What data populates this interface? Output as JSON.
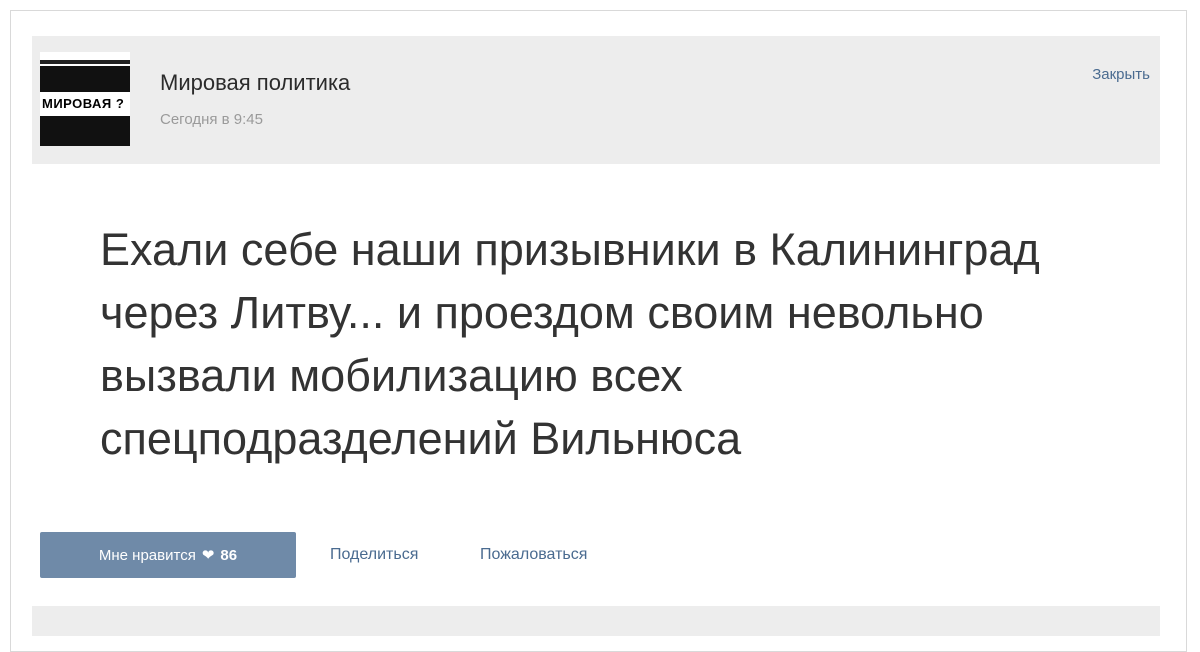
{
  "post": {
    "group_name": "Мировая политика",
    "time": "Сегодня в 9:45",
    "close_label": "Закрыть",
    "avatar_text": "МИРОВАЯ ?",
    "text": "Ехали себе наши призывники в Калининград через Литву... и проездом своим невольно вызвали мобилизацию всех спецподразделений Вильнюса"
  },
  "actions": {
    "like_label": "Мне нравится",
    "like_count": "86",
    "share_label": "Поделиться",
    "report_label": "Пожаловаться"
  },
  "colors": {
    "header_bg": "#ededed",
    "link": "#4a6b90",
    "like_button": "#6f8aa8"
  }
}
